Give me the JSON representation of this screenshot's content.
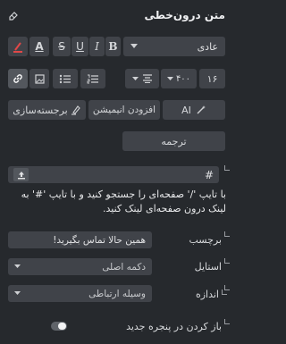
{
  "header": {
    "title": "متن درون‌خطی",
    "eraser_icon": "eraser-icon"
  },
  "toolbar1": {
    "font_select": "عادی",
    "buttons": [
      "B",
      "I",
      "U",
      "S",
      "A"
    ]
  },
  "toolbar2": {
    "font_size": "۱۶",
    "size_number": "۴۰۰"
  },
  "toolbar3": {
    "ai_label": "AI",
    "animation_label": "افزودن انیمیشن",
    "highlight_label": "برجسته‌سازی"
  },
  "translate_label": "ترجمه",
  "link_hash": "#",
  "help_text": "با تایپ '/' صفحه‌ای را جستجو کنید و با تایپ '#' به لینک درون صفحه‌ای لینک کنید.",
  "fields": {
    "label_title": "برچسب",
    "label_value": "همین حالا تماس بگیرید!",
    "style_title": "استایل",
    "style_value": "دکمه اصلی",
    "size_title": "اندازه",
    "size_value": "وسیله ارتباطی"
  },
  "new_window_label": "باز کردن در پنجره جدید",
  "colors": {
    "panel": "#26292d",
    "control": "#404349",
    "accent_red": "#e04848"
  }
}
